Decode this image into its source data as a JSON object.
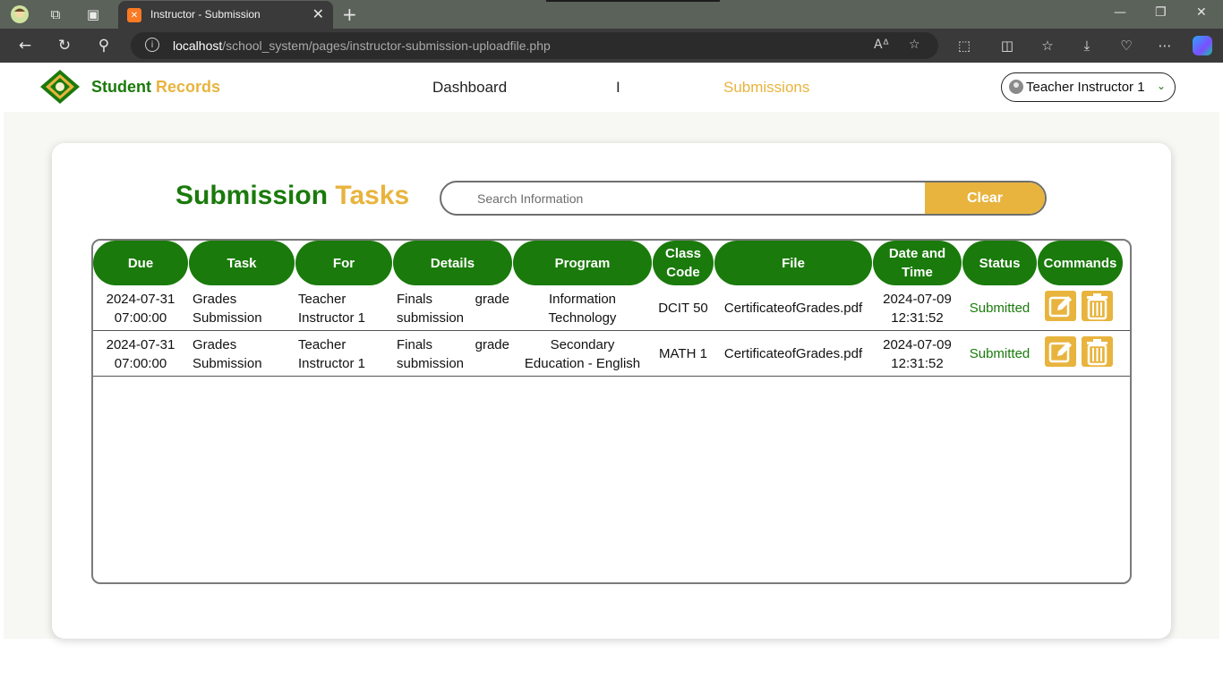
{
  "browser": {
    "tab_title": "Instructor - Submission",
    "url_host": "localhost",
    "url_path": "/school_system/pages/instructor-submission-uploadfile.php"
  },
  "header": {
    "brand_part1": "Student",
    "brand_part2": "Records",
    "nav": {
      "dashboard": "Dashboard",
      "separator": "I",
      "submissions": "Submissions"
    },
    "user": "Teacher Instructor 1"
  },
  "main": {
    "title_part1": "Submission",
    "title_part2": "Tasks",
    "search_placeholder": "Search Information",
    "clear_label": "Clear"
  },
  "table": {
    "headers": {
      "due": "Due",
      "task": "Task",
      "for": "For",
      "details": "Details",
      "program": "Program",
      "class_code_1": "Class",
      "class_code_2": "Code",
      "file": "File",
      "datetime_1": "Date and",
      "datetime_2": "Time",
      "status": "Status",
      "commands": "Commands"
    },
    "rows": [
      {
        "due_date": "2024-07-31",
        "due_time": "07:00:00",
        "task_1": "Grades",
        "task_2": "Submission",
        "for_1": "Teacher",
        "for_2": "Instructor 1",
        "details_1a": "Finals",
        "details_1b": "grade",
        "details_2": "submission",
        "program_1": "Information",
        "program_2": "Technology",
        "class_code": "DCIT 50",
        "file": "CertificateofGrades.pdf",
        "date": "2024-07-09",
        "time": "12:31:52",
        "status": "Submitted"
      },
      {
        "due_date": "2024-07-31",
        "due_time": "07:00:00",
        "task_1": "Grades",
        "task_2": "Submission",
        "for_1": "Teacher",
        "for_2": "Instructor 1",
        "details_1a": "Finals",
        "details_1b": "grade",
        "details_2": "submission",
        "program_1": "Secondary",
        "program_2": "Education - English",
        "class_code": "MATH 1",
        "file": "CertificateofGrades.pdf",
        "date": "2024-07-09",
        "time": "12:31:52",
        "status": "Submitted"
      }
    ]
  },
  "colors": {
    "green": "#1a7a0b",
    "gold": "#e8b43e"
  }
}
